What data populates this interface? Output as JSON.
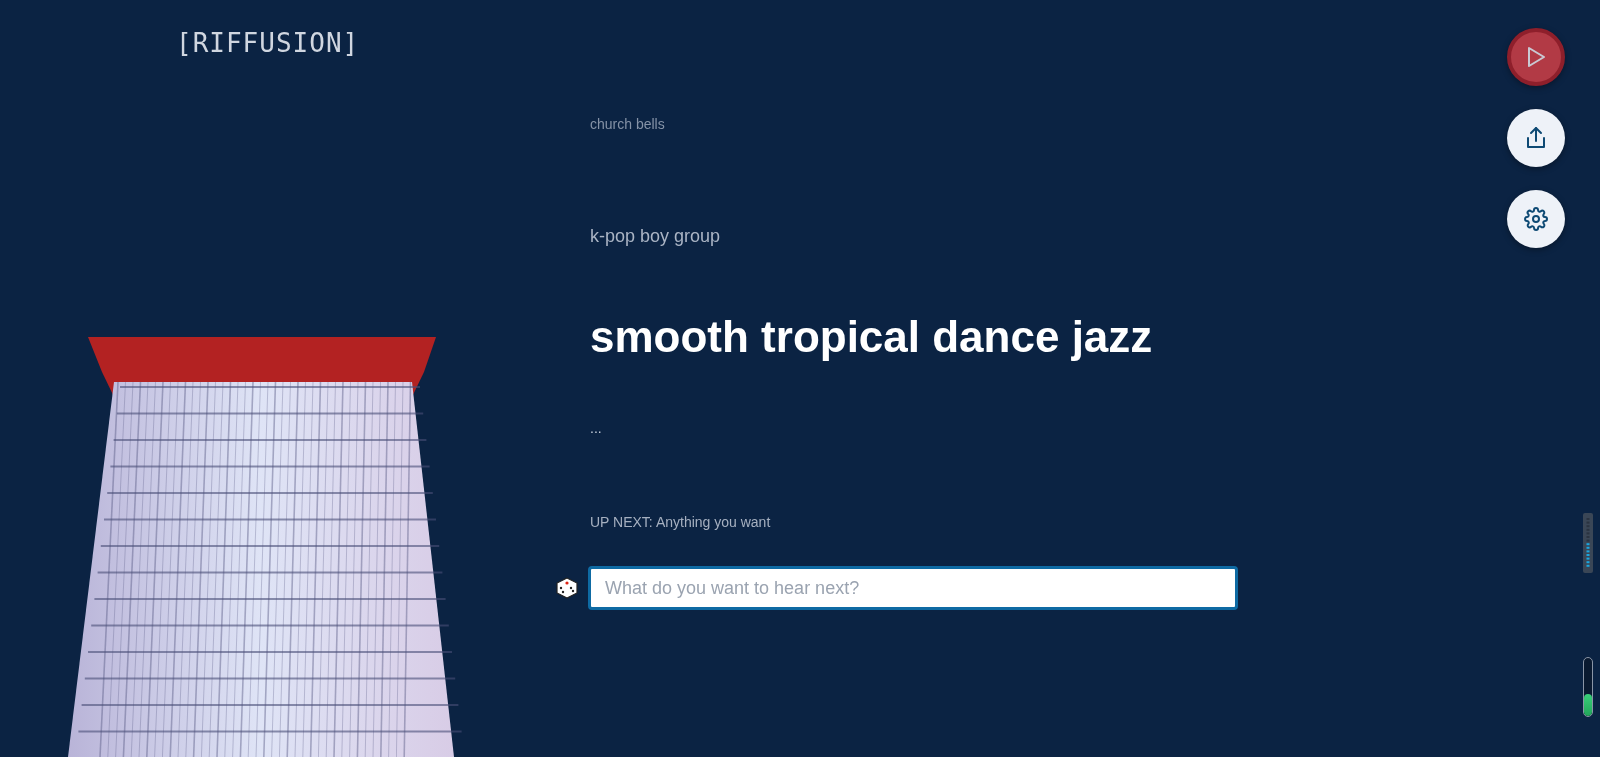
{
  "logo": "[RIFFUSION]",
  "prompts": [
    {
      "text": "church bells",
      "kind": "past"
    },
    {
      "text": "k-pop boy group",
      "kind": "recent"
    },
    {
      "text": "smooth tropical dance jazz",
      "kind": "current"
    },
    {
      "text": "...",
      "kind": "pending"
    }
  ],
  "up_next": "UP NEXT: Anything you want",
  "prompt_input": {
    "placeholder": "What do you want to hear next?"
  },
  "volume": {
    "level": 0.38
  }
}
